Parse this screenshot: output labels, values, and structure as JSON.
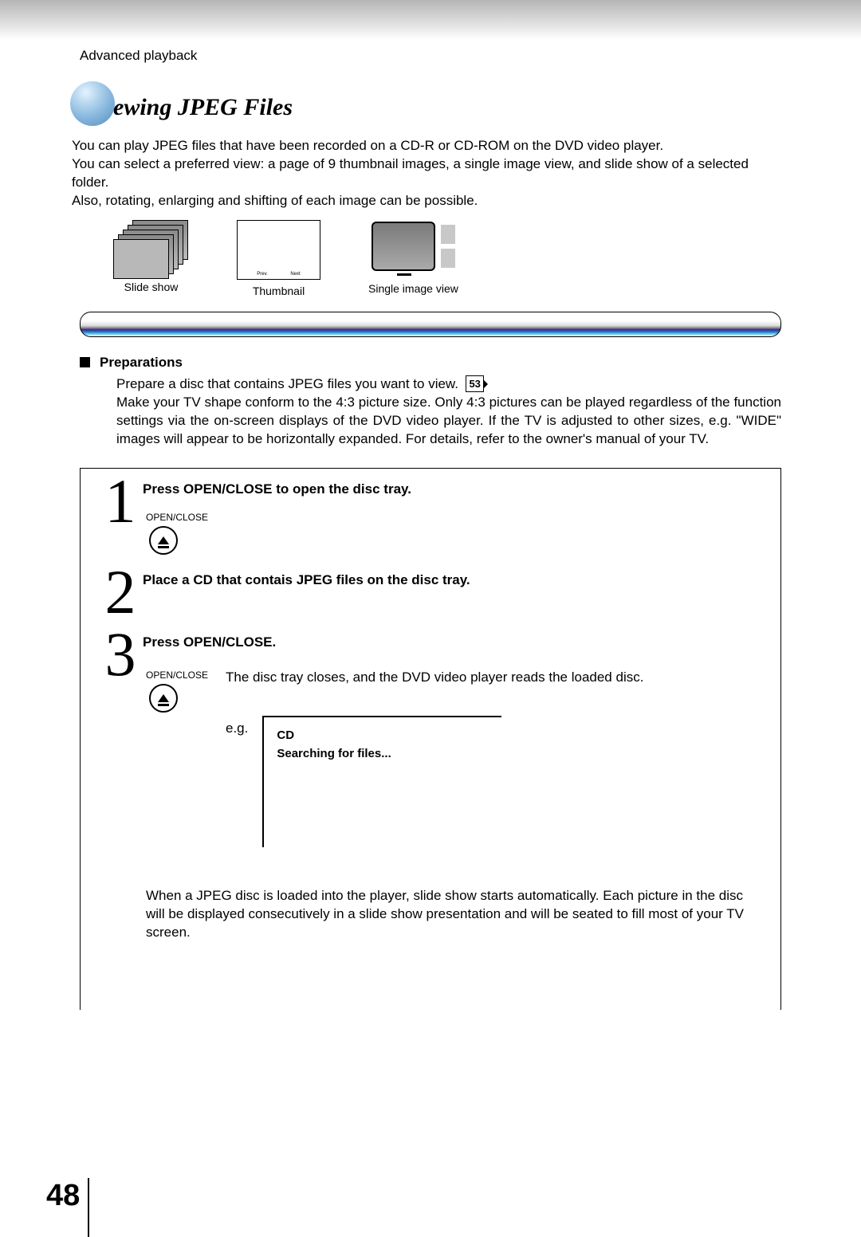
{
  "header": {
    "section": "Advanced playback"
  },
  "title": "ewing JPEG Files",
  "intro": {
    "line1": "You can play JPEG files that have been recorded on a CD-R or CD-ROM on the DVD video player.",
    "line2": "You can select a preferred view: a page of 9 thumbnail images, a single image view, and slide show of a selected folder.",
    "line3": "Also, rotating, enlarging and shifting of each image can be possible."
  },
  "views": {
    "slideshow": "Slide show",
    "thumbnail": "Thumbnail",
    "thumb_prev": "Prev.",
    "thumb_next": "Next",
    "single": "Single image view"
  },
  "preparations": {
    "heading": "Preparations",
    "line1a": "Prepare a disc that contains JPEG files you want to view.",
    "ref": "53",
    "body": "Make your TV shape conform to the 4:3 picture size. Only 4:3 pictures can be played regardless of the function settings via the on-screen displays of the DVD video player. If the TV is adjusted to other sizes, e.g. \"WIDE\" images will appear to be horizontally expanded. For details, refer to the owner's manual of your TV."
  },
  "steps": {
    "s1": {
      "num": "1",
      "title": "Press OPEN/CLOSE to open the disc tray.",
      "btn": "OPEN/CLOSE"
    },
    "s2": {
      "num": "2",
      "title": "Place a CD that contais JPEG files on the disc tray."
    },
    "s3": {
      "num": "3",
      "title": "Press OPEN/CLOSE.",
      "btn": "OPEN/CLOSE",
      "desc": "The disc tray closes, and the DVD video player reads the loaded disc.",
      "eg": "e.g.",
      "screen1": "CD",
      "screen2": "Searching for files...",
      "note": "When a JPEG disc is loaded into the player, slide show starts automatically. Each picture in the disc will be displayed consecutively in a slide show presentation and will be seated to fill most of your TV screen."
    }
  },
  "page_number": "48"
}
